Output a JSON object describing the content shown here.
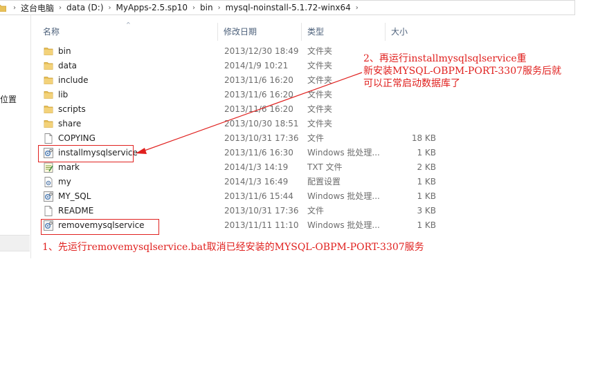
{
  "address_bar": {
    "crumbs": [
      "这台电脑",
      "data (D:)",
      "MyApps-2.5.sp10",
      "bin",
      "mysql-noinstall-5.1.72-winx64"
    ]
  },
  "nav": {
    "location_label": "位置"
  },
  "columns": {
    "name": "名称",
    "date": "修改日期",
    "type": "类型",
    "size": "大小"
  },
  "files": [
    {
      "name": "bin",
      "date": "2013/12/30 18:49",
      "type": "文件夹",
      "size": "",
      "icon": "folder-icon"
    },
    {
      "name": "data",
      "date": "2014/1/9 10:21",
      "type": "文件夹",
      "size": "",
      "icon": "folder-icon"
    },
    {
      "name": "include",
      "date": "2013/11/6 16:20",
      "type": "文件夹",
      "size": "",
      "icon": "folder-icon"
    },
    {
      "name": "lib",
      "date": "2013/11/6 16:20",
      "type": "文件夹",
      "size": "",
      "icon": "folder-icon"
    },
    {
      "name": "scripts",
      "date": "2013/11/6 16:20",
      "type": "文件夹",
      "size": "",
      "icon": "folder-icon"
    },
    {
      "name": "share",
      "date": "2013/10/30 18:51",
      "type": "文件夹",
      "size": "",
      "icon": "folder-icon"
    },
    {
      "name": "COPYING",
      "date": "2013/10/31 17:36",
      "type": "文件",
      "size": "18 KB",
      "icon": "file-icon"
    },
    {
      "name": "installmysqlservice",
      "date": "2013/11/6 16:30",
      "type": "Windows 批处理...",
      "size": "1 KB",
      "icon": "batch-file-icon"
    },
    {
      "name": "mark",
      "date": "2014/1/3 14:19",
      "type": "TXT 文件",
      "size": "2 KB",
      "icon": "text-file-icon"
    },
    {
      "name": "my",
      "date": "2014/1/3 16:49",
      "type": "配置设置",
      "size": "1 KB",
      "icon": "config-file-icon"
    },
    {
      "name": "MY_SQL",
      "date": "2013/11/6 15:44",
      "type": "Windows 批处理...",
      "size": "1 KB",
      "icon": "batch-file-icon"
    },
    {
      "name": "README",
      "date": "2013/10/31 17:36",
      "type": "文件",
      "size": "3 KB",
      "icon": "file-icon"
    },
    {
      "name": "removemysqlservice",
      "date": "2013/11/11 11:10",
      "type": "Windows 批处理...",
      "size": "1 KB",
      "icon": "batch-file-icon"
    }
  ],
  "annotations": {
    "step2_line1": "2、再运行installmysqlsqlservice重",
    "step2_line2": "新安装MYSQL-OBPM-PORT-3307服务后就",
    "step2_line3": "可以正常启动数据库了",
    "step1": "1、先运行removemysqlservice.bat取消已经安装的MYSQL-OBPM-PORT-3307服务"
  },
  "colors": {
    "annotation_red": "#e0201e",
    "folder_yellow": "#e8c15a",
    "header_text": "#4c607a"
  }
}
